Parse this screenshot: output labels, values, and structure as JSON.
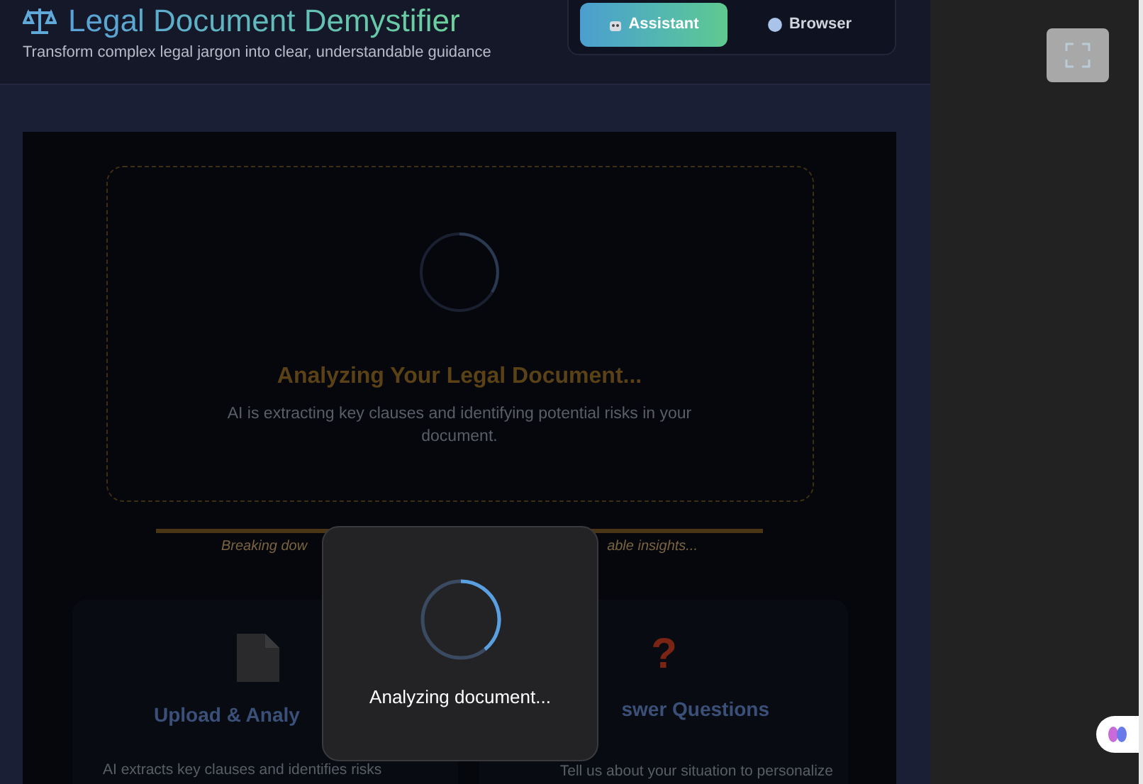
{
  "header": {
    "title": "Legal Document Demystifier",
    "subtitle": "Transform complex legal jargon into clear, understandable guidance",
    "tabs": [
      {
        "kind": "robot",
        "label": "Assistant",
        "selected": true
      },
      {
        "kind": "globe",
        "label": "Browser",
        "selected": false
      }
    ]
  },
  "analysis": {
    "title": "Analyzing Your Legal Document...",
    "description": "AI is extracting key clauses and identifying potential risks in your document.",
    "progress": {
      "level": 1
    },
    "caption_parts": [
      "Breaking dow",
      "able insights..."
    ]
  },
  "features": [
    {
      "kind": "document",
      "title": "Upload & Analy",
      "description": "AI extracts key clauses and identifies risks"
    },
    {
      "kind": "question",
      "icon": "?",
      "title": "swer Questions",
      "description": "Tell us about your situation to personalize"
    }
  ],
  "modal": {
    "message": "Analyzing document..."
  }
}
